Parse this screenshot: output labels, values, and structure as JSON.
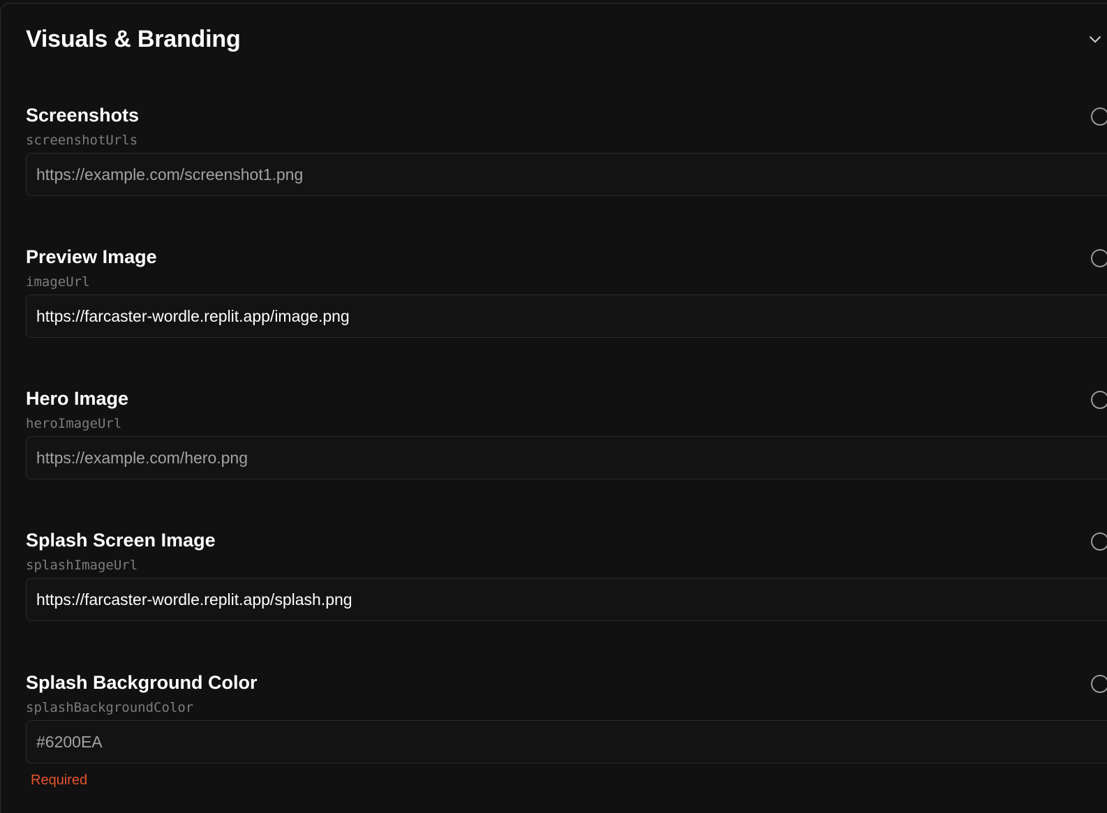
{
  "section": {
    "title": "Visuals & Branding",
    "collapse_icon": "chevron-down-icon"
  },
  "fields": [
    {
      "label": "Screenshots",
      "key": "screenshotUrls",
      "value": "https://example.com/screenshot1.png",
      "value_style": "placeholder",
      "info_icon": "info-circle-icon"
    },
    {
      "label": "Preview Image",
      "key": "imageUrl",
      "value": "https://farcaster-wordle.replit.app/image.png",
      "value_style": "filled",
      "info_icon": "info-circle-icon"
    },
    {
      "label": "Hero Image",
      "key": "heroImageUrl",
      "value": "https://example.com/hero.png",
      "value_style": "placeholder",
      "info_icon": "info-circle-icon"
    },
    {
      "label": "Splash Screen Image",
      "key": "splashImageUrl",
      "value": "https://farcaster-wordle.replit.app/splash.png",
      "value_style": "filled",
      "info_icon": "info-circle-icon"
    },
    {
      "label": "Splash Background Color",
      "key": "splashBackgroundColor",
      "value": "#6200EA",
      "value_style": "placeholder",
      "info_icon": "info-circle-icon",
      "error": "Required"
    }
  ],
  "colors": {
    "background": "#111111",
    "label": "#ffffff",
    "key": "#7c7c7c",
    "placeholder": "#a3a3a3",
    "error": "#e5532f"
  }
}
